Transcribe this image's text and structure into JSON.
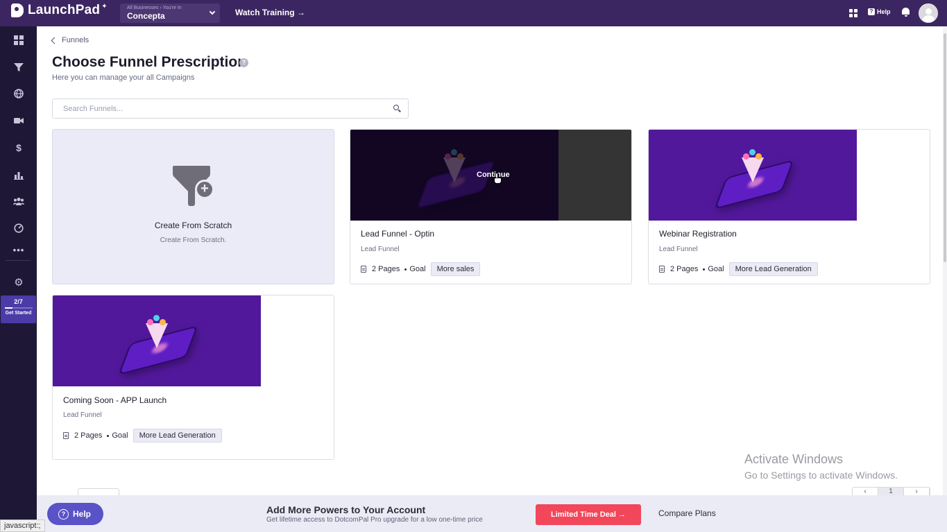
{
  "topbar": {
    "brand": "LaunchPad",
    "business_caption": "All Businesses › You're In",
    "business_name": "Concepta",
    "watch_training": "Watch Training →",
    "help_label": "Help",
    "help_glyph": "?"
  },
  "sidebar": {
    "icons": [
      "dashboard-icon",
      "funnel-icon",
      "globe-icon",
      "video-icon",
      "dollar-icon",
      "chart-icon",
      "users-icon",
      "gauge-icon",
      "more-icon",
      "gear-icon"
    ],
    "get_started": {
      "count": "2/7",
      "progress": 0.286,
      "label": "Get Started"
    }
  },
  "breadcrumb": {
    "back_label": "Funnels"
  },
  "page": {
    "title": "Choose Funnel Prescription",
    "subtitle": "Here you can manage your all Campaigns"
  },
  "search": {
    "placeholder": "Search Funnels..."
  },
  "scratch_card": {
    "title": "Create From Scratch",
    "subtitle": "Create From Scratch."
  },
  "funnels": [
    {
      "title": "Lead Funnel - Optin",
      "category": "Lead Funnel",
      "pages": "2 Pages",
      "goal_label": "Goal",
      "goal": "More sales",
      "overlay": "Continue"
    },
    {
      "title": "Webinar Registration",
      "category": "Lead Funnel",
      "pages": "2 Pages",
      "goal_label": "Goal",
      "goal": "More Lead Generation"
    },
    {
      "title": "Coming Soon - APP Launch",
      "category": "Lead Funnel",
      "pages": "2 Pages",
      "goal_label": "Goal",
      "goal": "More Lead Generation"
    }
  ],
  "pagination": {
    "current": "1",
    "prev": "‹",
    "next": "›"
  },
  "upgrade": {
    "title": "Add More Powers to Your Account",
    "subtitle": "Get lifetime access to DotcomPal Pro upgrade for a low one-time price",
    "deal_button": "Limited Time Deal →",
    "compare": "Compare Plans"
  },
  "help_button": "Help",
  "activate_windows": {
    "title": "Activate Windows",
    "subtitle": "Go to Settings to activate Windows."
  },
  "status_url": "javascript:;",
  "colors": {
    "topbar": "#3c2661",
    "sidebar": "#1e1836",
    "accent": "#5a52c7",
    "deal": "#f2475a",
    "thumb": "#52189b"
  }
}
